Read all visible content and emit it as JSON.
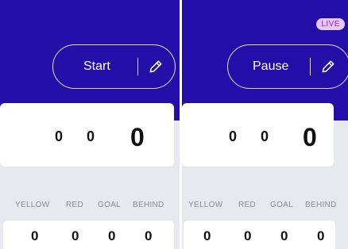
{
  "colors": {
    "header": "#250ea8",
    "background": "#e8e9ee",
    "live_bg": "#e6c7f7",
    "live_text": "#8a2bbf"
  },
  "panels": [
    {
      "control_label": "Start",
      "edit_icon": "pencil-icon",
      "score": {
        "goals": "0",
        "behinds": "0",
        "total": "0"
      },
      "stat_labels": [
        "YELLOW",
        "RED",
        "GOAL",
        "BEHIND"
      ],
      "stat_values": [
        "0",
        "0",
        "0",
        "0"
      ]
    },
    {
      "badge": "LIVE",
      "control_label": "Pause",
      "edit_icon": "pencil-icon",
      "score": {
        "goals": "0",
        "behinds": "0",
        "total": "0"
      },
      "stat_labels": [
        "YELLOW",
        "RED",
        "GOAL",
        "BEHIND"
      ],
      "stat_values": [
        "0",
        "0",
        "0",
        "0"
      ]
    }
  ]
}
